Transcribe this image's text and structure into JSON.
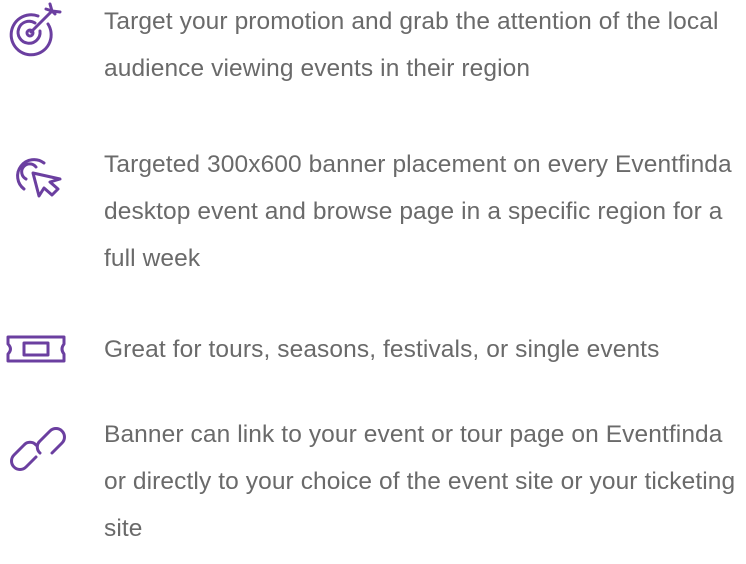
{
  "accent_color": "#6b3fa0",
  "text_color": "#6a6a6a",
  "features": [
    {
      "icon": "target-icon",
      "text": "Target your promotion and grab the attention of the local audience viewing events in their region"
    },
    {
      "icon": "cursor-click-icon",
      "text": "Targeted 300x600 banner placement on every Eventfinda desktop event and browse page in a specific region for a full week"
    },
    {
      "icon": "ticket-icon",
      "text": "Great for tours, seasons, festivals, or single events"
    },
    {
      "icon": "link-icon",
      "text": "Banner can link to your event or tour page on Eventfinda or directly to your choice of the event site or your ticketing site"
    }
  ]
}
